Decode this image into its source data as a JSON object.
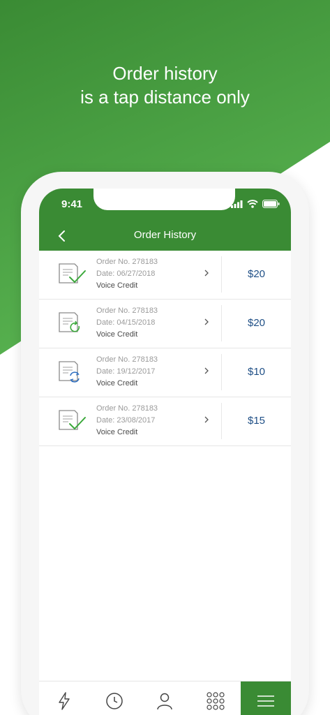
{
  "promo": {
    "line1": "Order history",
    "line2": "is a tap distance only"
  },
  "status_bar": {
    "time": "9:41"
  },
  "nav": {
    "title": "Order History",
    "back_icon": "chevron-left-icon"
  },
  "orders": [
    {
      "order_no": "Order No. 278183",
      "date": "Date: 06/27/2018",
      "product": "Voice Credit",
      "amount": "$20",
      "status": "completed"
    },
    {
      "order_no": "Order No. 278183",
      "date": "Date: 04/15/2018",
      "product": "Voice Credit",
      "amount": "$20",
      "status": "refresh"
    },
    {
      "order_no": "Order No. 278183",
      "date": "Date: 19/12/2017",
      "product": "Voice Credit",
      "amount": "$10",
      "status": "processing"
    },
    {
      "order_no": "Order No. 278183",
      "date": "Date: 23/08/2017",
      "product": "Voice Credit",
      "amount": "$15",
      "status": "completed"
    }
  ],
  "tabs": [
    {
      "icon": "lightning-icon"
    },
    {
      "icon": "clock-icon"
    },
    {
      "icon": "user-icon"
    },
    {
      "icon": "keypad-icon"
    },
    {
      "icon": "menu-icon",
      "active": true
    }
  ],
  "colors": {
    "brand_green": "#3a8b34",
    "amount_blue": "#1f4f86",
    "check_green": "#3aa83a",
    "sync_blue": "#2f6fc0"
  }
}
